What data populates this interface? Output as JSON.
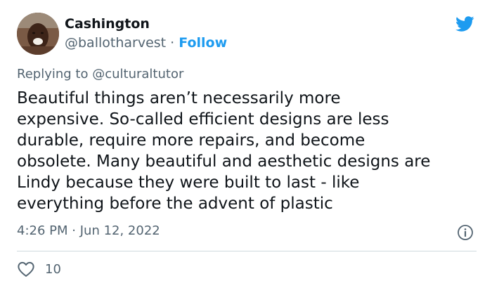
{
  "author": {
    "name": "Cashington",
    "handle": "@ballotharvest",
    "separator": "·",
    "follow_label": "Follow"
  },
  "reply_context": {
    "prefix": "Replying to",
    "mention": "@culturaltutor"
  },
  "tweet": {
    "lines": [
      "Beautiful things aren’t necessarily more",
      "expensive. So-called efficient designs are less",
      "durable, require more repairs, and become",
      "obsolete. Many beautiful and aesthetic designs are",
      "Lindy because they were built to last - like",
      "everything before the advent of plastic"
    ],
    "time": "4:26 PM",
    "separator": "·",
    "date": "Jun 12, 2022"
  },
  "engagement": {
    "like_count": "10"
  },
  "icons": {
    "brand": "twitter-bird-icon",
    "info": "info-icon",
    "like": "heart-icon"
  },
  "colors": {
    "accent": "#1d9bf0",
    "secondary_text": "#536471",
    "primary_text": "#0f1419",
    "divider": "#cfd9de"
  }
}
